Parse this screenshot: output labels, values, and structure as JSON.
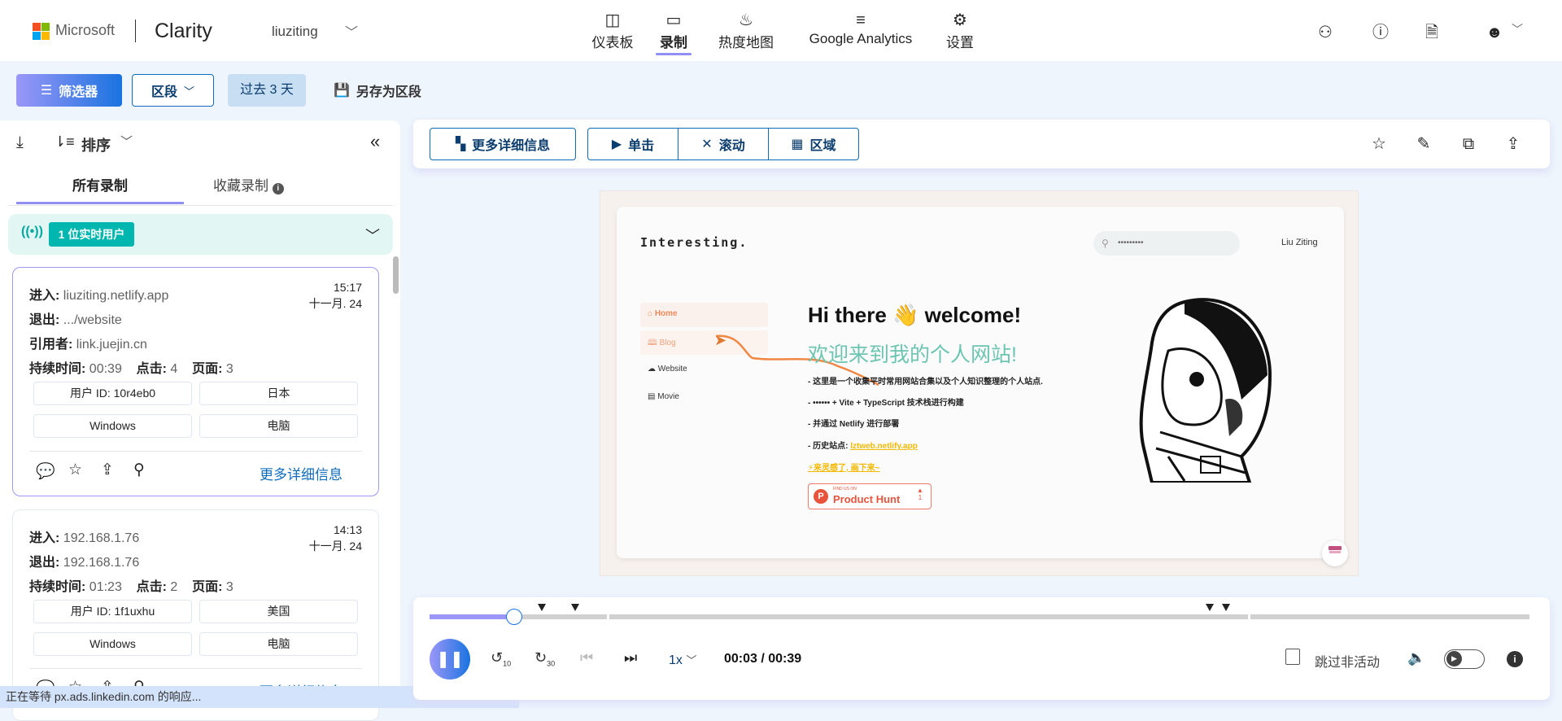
{
  "header": {
    "brand": "Microsoft",
    "product": "Clarity",
    "project": "liuziting",
    "nav": [
      {
        "label": "仪表板",
        "icon": "dashboard-icon"
      },
      {
        "label": "录制",
        "icon": "video-icon",
        "active": true
      },
      {
        "label": "热度地图",
        "icon": "flame-icon"
      },
      {
        "label": "Google Analytics",
        "icon": "analytics-icon"
      },
      {
        "label": "设置",
        "icon": "gear-icon"
      }
    ]
  },
  "filterbar": {
    "filters": "筛选器",
    "segment": "区段",
    "range": "过去 3 天",
    "save_segment": "另存为区段"
  },
  "sidebar": {
    "sort": "排序",
    "tabs": [
      "所有录制",
      "收藏录制"
    ],
    "live_users": "1 位实时用户",
    "labels": {
      "entry": "进入",
      "exit": "退出",
      "referrer": "引用者",
      "duration": "持续时间",
      "clicks": "点击",
      "pages": "页面",
      "more": "更多详细信息"
    },
    "recordings": [
      {
        "entry": "liuziting.netlify.app",
        "exit": ".../website",
        "referrer": "link.juejin.cn",
        "duration": "00:39",
        "clicks": "4",
        "pages": "3",
        "time": "15:17",
        "date": "十一月. 24",
        "user_id": "用户 ID: 10r4eb0",
        "country": "日本",
        "os": "Windows",
        "device": "电脑"
      },
      {
        "entry": "192.168.1.76",
        "exit": "192.168.1.76",
        "duration": "01:23",
        "clicks": "2",
        "pages": "3",
        "time": "14:13",
        "date": "十一月. 24",
        "user_id": "用户 ID: 1f1uxhu",
        "country": "美国",
        "os": "Windows",
        "device": "电脑"
      }
    ]
  },
  "toolbar": {
    "more_details": "更多详细信息",
    "click": "单击",
    "scroll": "滚动",
    "area": "区域"
  },
  "replay": {
    "site_title": "Interesting.",
    "search": "•••••••••",
    "user": "Liu Ziting",
    "nav": [
      "Home",
      "Blog",
      "Website",
      "Movie"
    ],
    "hello": "Hi there 👋 welcome!",
    "welcome_cn": "欢迎来到我的个人网站!",
    "bullets": [
      "- 这里是一个收集平时常用网站合集以及个人知识整理的个人站点.",
      "- •••••• + Vite + TypeScript 技术栈进行构建",
      "- 并通过 Netlify 进行部署"
    ],
    "history_label": "- 历史站点: ",
    "history_link": "lztweb.netlify.app",
    "inspire": "来灵感了, 画下来~",
    "ph_small": "FIND US ON",
    "ph_name": "Product Hunt",
    "ph_count": "1"
  },
  "player": {
    "progress": 0.077,
    "speed": "1x",
    "time": "00:03 / 00:39",
    "skip_inactive": "跳过非活动",
    "skip_checked": false
  },
  "status_bar": "正在等待 px.ads.linkedin.com 的响应...",
  "colors": {
    "accent": "#8f8ff6",
    "blue": "#0f6cbd",
    "teal": "#00b7b0",
    "link": "#0f6cbd"
  }
}
